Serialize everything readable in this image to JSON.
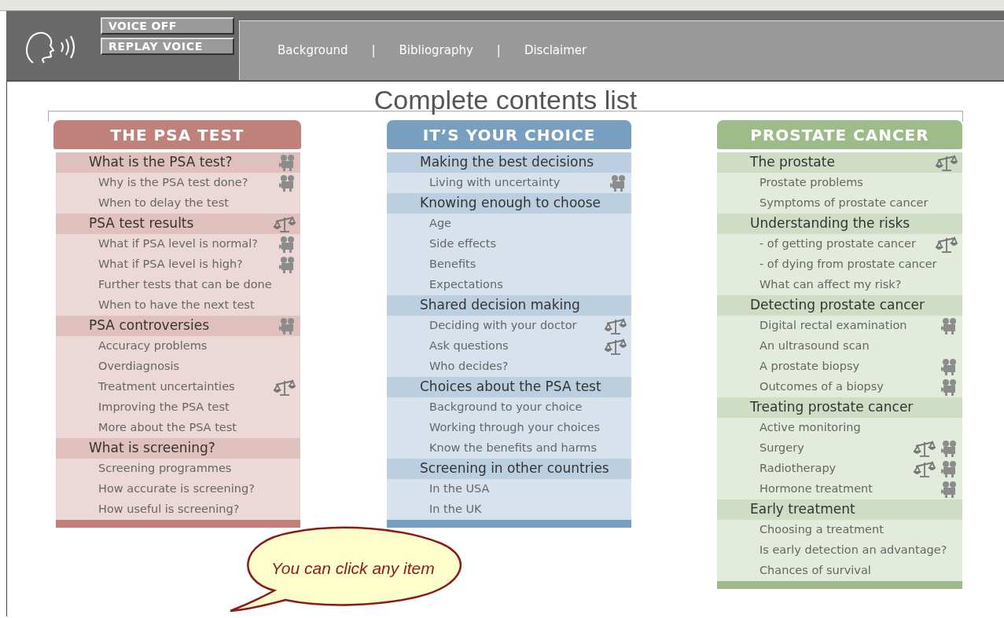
{
  "toolbar": {
    "voice_buttons": [
      "VOICE OFF",
      "REPLAY VOICE"
    ],
    "links": [
      "Background",
      "Bibliography",
      "Disclaimer"
    ],
    "separators": [
      "|",
      "|"
    ]
  },
  "title": "Complete contents list",
  "columns": [
    {
      "color": "#c0817b",
      "title": "THE PSA TEST",
      "items": [
        {
          "kind": "heading",
          "label": "What is the PSA test?",
          "video": true
        },
        {
          "kind": "sub",
          "label": "Why is the PSA test done?",
          "video": true
        },
        {
          "kind": "sub",
          "label": "When to delay the test"
        },
        {
          "kind": "heading",
          "label": "PSA test results",
          "scales": true
        },
        {
          "kind": "sub",
          "label": "What if PSA level is normal?",
          "video": true
        },
        {
          "kind": "sub",
          "label": "What if PSA level is high?",
          "video": true
        },
        {
          "kind": "sub",
          "label": "Further tests that can be done"
        },
        {
          "kind": "sub",
          "label": "When to have the next test"
        },
        {
          "kind": "heading",
          "label": "PSA controversies",
          "video": true
        },
        {
          "kind": "sub",
          "label": "Accuracy problems"
        },
        {
          "kind": "sub",
          "label": "Overdiagnosis"
        },
        {
          "kind": "sub",
          "label": "Treatment uncertainties",
          "scales": true
        },
        {
          "kind": "sub",
          "label": "Improving the PSA test"
        },
        {
          "kind": "sub",
          "label": "More about the PSA test"
        },
        {
          "kind": "heading",
          "label": "What is screening?"
        },
        {
          "kind": "sub",
          "label": "Screening programmes"
        },
        {
          "kind": "sub",
          "label": "How accurate is screening?"
        },
        {
          "kind": "sub",
          "label": "How useful is screening?"
        }
      ]
    },
    {
      "color": "#789fc0",
      "title": "IT’S YOUR CHOICE",
      "items": [
        {
          "kind": "heading",
          "label": "Making the best decisions"
        },
        {
          "kind": "sub",
          "label": "Living with uncertainty",
          "video": true
        },
        {
          "kind": "heading",
          "label": "Knowing enough to choose"
        },
        {
          "kind": "sub",
          "label": "Age"
        },
        {
          "kind": "sub",
          "label": "Side effects"
        },
        {
          "kind": "sub",
          "label": "Benefits"
        },
        {
          "kind": "sub",
          "label": "Expectations"
        },
        {
          "kind": "heading",
          "label": "Shared decision making"
        },
        {
          "kind": "sub",
          "label": "Deciding with your doctor",
          "scales": true
        },
        {
          "kind": "sub",
          "label": "Ask questions",
          "scales": true
        },
        {
          "kind": "sub",
          "label": "Who decides?"
        },
        {
          "kind": "heading",
          "label": "Choices about the PSA test"
        },
        {
          "kind": "sub",
          "label": "Background to your choice"
        },
        {
          "kind": "sub",
          "label": "Working through your choices"
        },
        {
          "kind": "sub",
          "label": "Know the benefits and harms"
        },
        {
          "kind": "heading",
          "label": "Screening in other countries"
        },
        {
          "kind": "sub",
          "label": "In the USA"
        },
        {
          "kind": "sub",
          "label": "In the UK"
        }
      ]
    },
    {
      "color": "#9ebb8a",
      "title": "PROSTATE CANCER",
      "items": [
        {
          "kind": "heading",
          "label": "The prostate",
          "scales": true
        },
        {
          "kind": "sub",
          "label": "Prostate problems"
        },
        {
          "kind": "sub",
          "label": "Symptoms of prostate cancer"
        },
        {
          "kind": "heading",
          "label": "Understanding the risks"
        },
        {
          "kind": "sub",
          "label": "- of getting prostate cancer",
          "scales": true
        },
        {
          "kind": "sub",
          "label": "- of dying from prostate cancer"
        },
        {
          "kind": "sub",
          "label": "What can affect my risk?"
        },
        {
          "kind": "heading",
          "label": "Detecting prostate cancer"
        },
        {
          "kind": "sub",
          "label": "Digital rectal examination",
          "video": true
        },
        {
          "kind": "sub",
          "label": "An ultrasound scan"
        },
        {
          "kind": "sub",
          "label": "A prostate biopsy",
          "video": true
        },
        {
          "kind": "sub",
          "label": "Outcomes of a biopsy",
          "video": true
        },
        {
          "kind": "heading",
          "label": "Treating prostate cancer"
        },
        {
          "kind": "sub",
          "label": "Active monitoring"
        },
        {
          "kind": "sub",
          "label": "Surgery",
          "scales": true,
          "video": true
        },
        {
          "kind": "sub",
          "label": "Radiotherapy",
          "scales": true,
          "video": true
        },
        {
          "kind": "sub",
          "label": "Hormone treatment",
          "video": true
        },
        {
          "kind": "heading",
          "label": "Early treatment"
        },
        {
          "kind": "sub",
          "label": "Choosing a treatment"
        },
        {
          "kind": "sub",
          "label": "Is early detection an advantage?"
        },
        {
          "kind": "sub",
          "label": "Chances of survival"
        }
      ]
    }
  ],
  "callout": "You can click any item"
}
